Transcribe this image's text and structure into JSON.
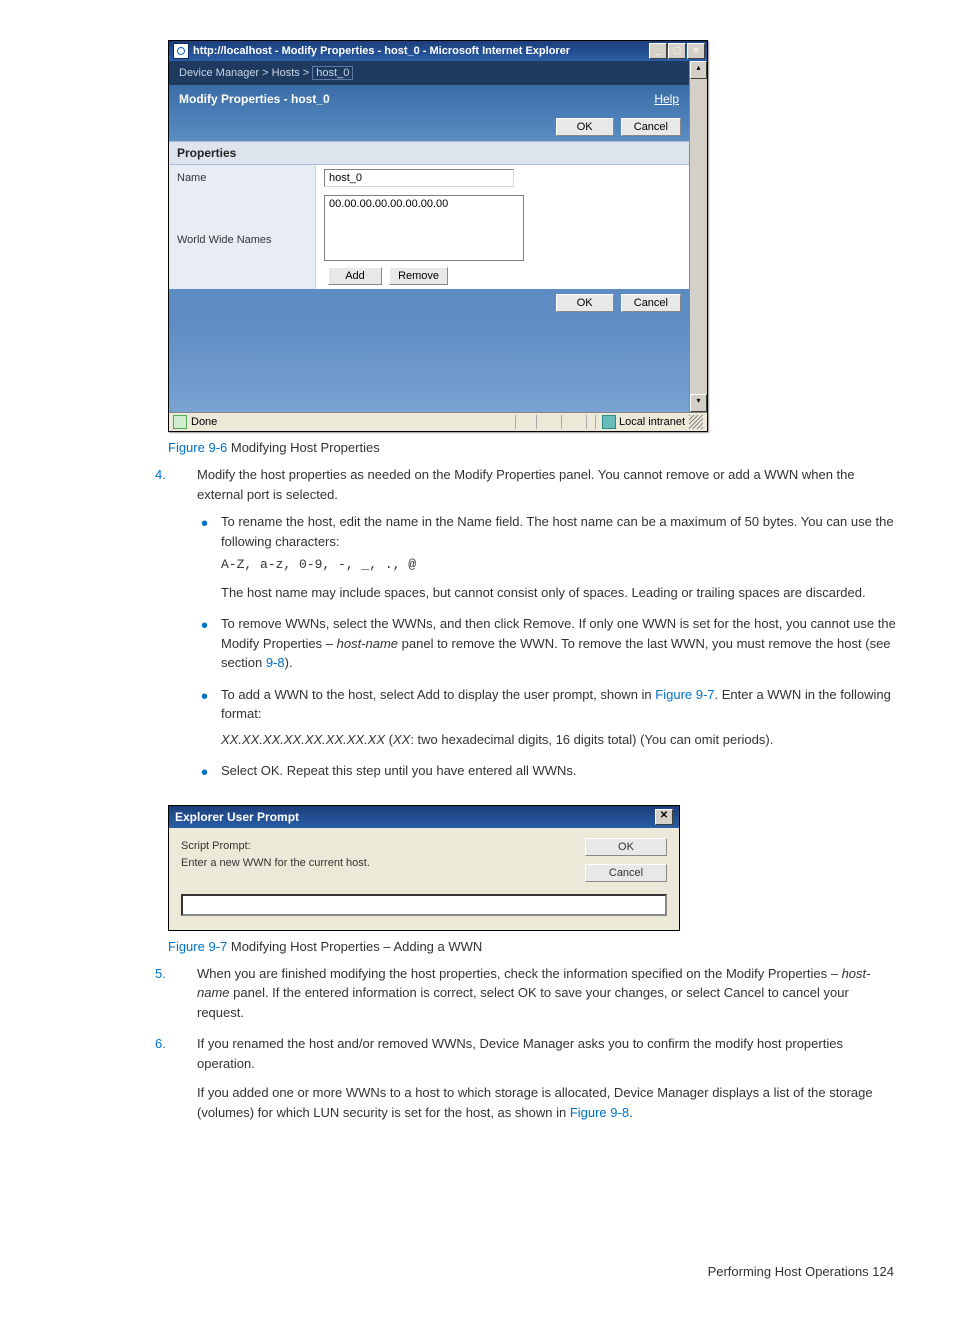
{
  "ie": {
    "titlebar": "http://localhost - Modify Properties - host_0 - Microsoft Internet Explorer",
    "breadcrumb_prefix": "Device Manager > Hosts > ",
    "breadcrumb_host": "host_0",
    "header": "Modify Properties - host_0",
    "help": "Help",
    "ok": "OK",
    "cancel": "Cancel",
    "properties_header": "Properties",
    "name_label": "Name",
    "name_value": "host_0",
    "wwn_label": "World Wide Names",
    "wwn_value": "00.00.00.00.00.00.00.00",
    "add": "Add",
    "remove": "Remove",
    "status_done": "Done",
    "status_zone": "Local intranet"
  },
  "fig1": {
    "ref": "Figure 9-6",
    "caption": " Modifying Host Properties"
  },
  "step4": {
    "num": "4.",
    "text": "Modify the host properties as needed on the Modify Properties panel. You cannot remove or add a WWN when the external port is selected.",
    "b1a": "To rename the host, edit the name in the Name field. The host name can be a maximum of 50 bytes. You can use the following characters:",
    "chars": "A-Z, a-z, 0-9, -, _, ., @",
    "b1b": "The host name may include spaces, but cannot consist only of spaces. Leading or trailing spaces are discarded.",
    "b2a": "To remove WWNs, select the WWNs, and then click Remove. If only one WWN is set for the host, you cannot use the Modify Properties – ",
    "b2ital": "host-name",
    "b2b": " panel to remove the WWN. To remove the last WWN, you must remove the host (see section ",
    "b2link": "9-8",
    "b2c": ").",
    "b3a": "To add a WWN to the host, select Add to display the user prompt, shown in ",
    "b3link": "Figure 9-7",
    "b3b": ". Enter a WWN in the following format:",
    "b3fmt_i": "XX.XX.XX.XX.XX.XX.XX.XX",
    "b3fmt_mid": " (",
    "b3fmt_xx": "XX",
    "b3fmt_rest": ": two hexadecimal digits, 16 digits total) (You can omit periods).",
    "b4": "Select OK. Repeat this step until you have entered all WWNs."
  },
  "prompt": {
    "title": "Explorer User Prompt",
    "line1": "Script Prompt:",
    "line2": "Enter a new WWN for the current host.",
    "ok": "OK",
    "cancel": "Cancel"
  },
  "fig2": {
    "ref": "Figure 9-7",
    "caption": " Modifying Host Properties – Adding a WWN"
  },
  "step5": {
    "num": "5.",
    "a": "When you are finished modifying the host properties, check the information specified on the Modify Properties – ",
    "ital": "host-name",
    "b": " panel. If the entered information is correct, select OK to save your changes, or select Cancel to cancel your request."
  },
  "step6": {
    "num": "6.",
    "a": "If you renamed the host and/or removed WWNs, Device Manager asks you to confirm the modify host properties operation.",
    "b": "If you added one or more WWNs to a host to which storage is allocated, Device Manager displays a list of the storage (volumes) for which LUN security is set for the host, as shown in ",
    "link": "Figure 9-8",
    "c": "."
  },
  "footer": {
    "text": "Performing Host Operations   124"
  }
}
